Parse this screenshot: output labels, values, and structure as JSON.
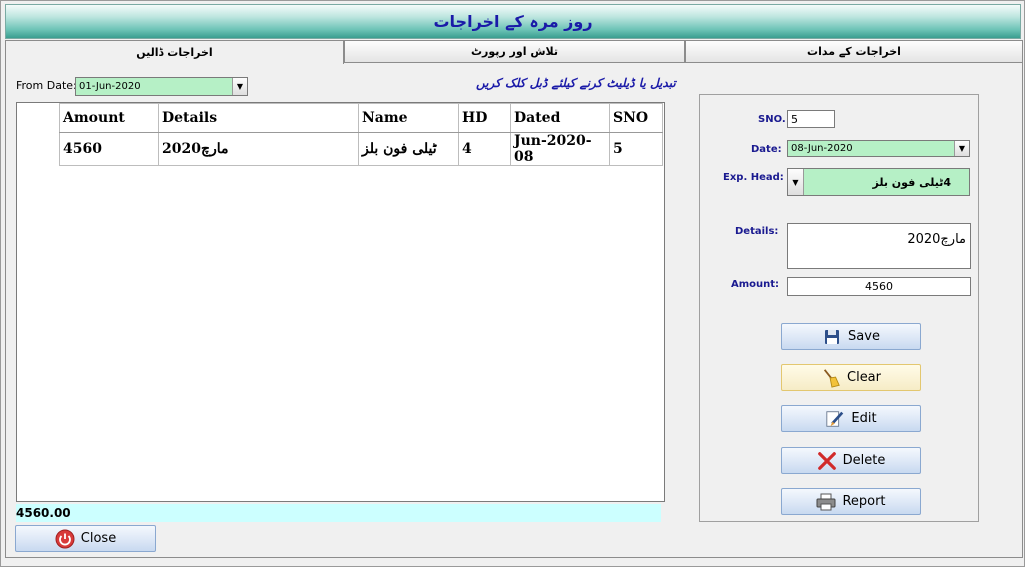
{
  "window": {
    "title": "روز مرہ کے اخراجات"
  },
  "tabs": [
    {
      "label": "اخراجات ڈالیں"
    },
    {
      "label": "تلاش اور رپورٹ"
    },
    {
      "label": "اخراجات کے مدات"
    }
  ],
  "filter": {
    "from_label": "From Date:",
    "from_value": "01-Jun-2020"
  },
  "hint": "تبدیل یا ڈیلیٹ کرنے کیلئے ڈبل کلک کریں",
  "table": {
    "headers": [
      "Amount",
      "Details",
      "Name",
      "HD",
      "Dated",
      "SNO"
    ],
    "rows": [
      [
        "4560",
        "مارچ2020",
        "ٹیلی فون بلز",
        "4",
        "Jun-2020-08",
        "5"
      ]
    ]
  },
  "total": "4560.00",
  "form": {
    "sno_label": "SNO.",
    "sno_value": "5",
    "date_label": "Date:",
    "date_value": "08-Jun-2020",
    "exp_head_label": "Exp. Head:",
    "exp_head_value": "4ٹیلی فون بلز",
    "details_label": "Details:",
    "details_value": "مارچ2020",
    "amount_label": "Amount:",
    "amount_value": "4560"
  },
  "buttons": {
    "save": "Save",
    "clear": "Clear",
    "edit": "Edit",
    "delete": "Delete",
    "report": "Report",
    "close": "Close"
  },
  "colors": {
    "title_text": "#1a1aa8",
    "input_green": "#b6f0c6",
    "total_bar": "#ccffff"
  }
}
